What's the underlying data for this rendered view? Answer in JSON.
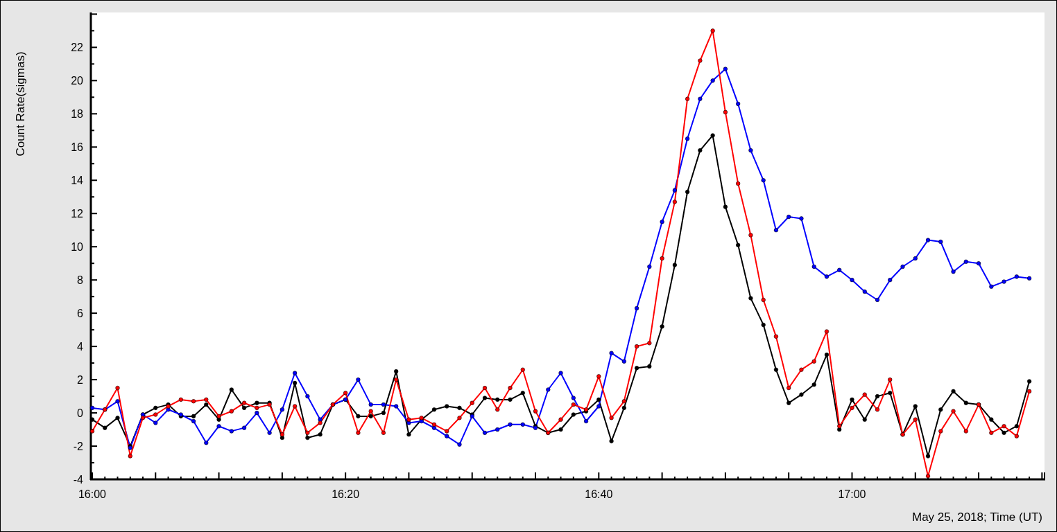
{
  "chart": {
    "chart_data": {
      "type": "line",
      "xlabel": "May 25, 2018; Time (UT)",
      "ylabel": "Count Rate(sigmas)",
      "categories": [
        "16:00",
        null,
        null,
        null,
        null,
        null,
        null,
        null,
        null,
        null,
        null,
        null,
        null,
        null,
        null,
        null,
        null,
        null,
        null,
        null,
        "16:20",
        null,
        null,
        null,
        null,
        null,
        null,
        null,
        null,
        null,
        null,
        null,
        null,
        null,
        null,
        null,
        null,
        null,
        null,
        null,
        "16:40",
        null,
        null,
        null,
        null,
        null,
        null,
        null,
        null,
        null,
        null,
        null,
        null,
        null,
        null,
        null,
        null,
        null,
        null,
        null,
        "17:00",
        null,
        null,
        null,
        null,
        null,
        null,
        null,
        null,
        null,
        null,
        null,
        null,
        null,
        null
      ],
      "ylim": [
        -4,
        24.1
      ],
      "yticks": [
        -4,
        -2,
        0,
        2,
        4,
        6,
        8,
        10,
        12,
        14,
        16,
        18,
        20,
        22
      ],
      "series": [
        {
          "color": "#000000",
          "marker": "circle",
          "values": [
            -0.4,
            -0.9,
            -0.3,
            -2.0,
            -0.1,
            0.3,
            0.5,
            -0.2,
            -0.2,
            0.5,
            -0.4,
            1.4,
            0.3,
            0.6,
            0.6,
            -1.5,
            1.8,
            -1.5,
            -1.3,
            0.5,
            0.8,
            -0.2,
            -0.2,
            0.0,
            2.5,
            -1.3,
            -0.4,
            0.2,
            0.4,
            0.3,
            -0.1,
            0.9,
            0.8,
            0.8,
            1.2,
            -0.8,
            -1.2,
            -1.0,
            -0.1,
            0.1,
            0.8,
            -1.7,
            0.3,
            2.7,
            2.8,
            5.2,
            8.9,
            13.3,
            15.8,
            16.7,
            12.4,
            10.1,
            6.9,
            5.3,
            2.6,
            0.6,
            1.1,
            1.7,
            3.5,
            -1.0,
            0.8,
            -0.4,
            1.0,
            1.2,
            -1.3,
            0.4,
            -2.6,
            0.2,
            1.3,
            0.6,
            0.5,
            -0.4,
            -1.2,
            -0.8,
            1.9
          ]
        },
        {
          "color": "#0000ff",
          "marker": "circle",
          "values": [
            0.3,
            0.2,
            0.7,
            -2.1,
            -0.1,
            -0.6,
            0.2,
            -0.1,
            -0.5,
            -1.8,
            -0.8,
            -1.1,
            -0.9,
            0.0,
            -1.2,
            0.2,
            2.4,
            1.0,
            -0.4,
            0.5,
            0.8,
            2.0,
            0.5,
            0.5,
            0.4,
            -0.6,
            -0.5,
            -0.9,
            -1.4,
            -1.9,
            -0.2,
            -1.2,
            -1.0,
            -0.7,
            -0.7,
            -0.9,
            1.4,
            2.4,
            0.9,
            -0.5,
            0.4,
            3.6,
            3.1,
            6.3,
            8.8,
            11.5,
            13.4,
            16.5,
            18.9,
            20.0,
            20.7,
            18.6,
            15.8,
            14.0,
            11.0,
            11.8,
            11.7,
            8.8,
            8.2,
            8.6,
            8.0,
            7.3,
            6.8,
            8.0,
            8.8,
            9.3,
            10.4,
            10.3,
            8.5,
            9.1,
            9.0,
            7.6,
            7.9,
            8.2,
            8.1
          ]
        },
        {
          "color": "#ff0000",
          "marker": "circle",
          "values": [
            -1.1,
            0.2,
            1.5,
            -2.6,
            -0.3,
            -0.1,
            0.4,
            0.8,
            0.7,
            0.8,
            -0.2,
            0.1,
            0.6,
            0.3,
            0.5,
            -1.3,
            0.4,
            -1.2,
            -0.6,
            0.5,
            1.2,
            -1.2,
            0.1,
            -1.2,
            2.0,
            -0.4,
            -0.3,
            -0.7,
            -1.1,
            -0.3,
            0.6,
            1.5,
            0.2,
            1.5,
            2.6,
            0.1,
            -1.2,
            -0.4,
            0.5,
            0.2,
            2.2,
            -0.3,
            0.7,
            4.0,
            4.2,
            9.3,
            12.7,
            18.9,
            21.2,
            23.0,
            18.1,
            13.8,
            10.7,
            6.8,
            4.6,
            1.5,
            2.6,
            3.1,
            4.9,
            -0.8,
            0.3,
            1.1,
            0.2,
            2.0,
            -1.3,
            -0.4,
            -3.8,
            -1.1,
            0.1,
            -1.1,
            0.5,
            -1.2,
            -0.8,
            -1.4,
            1.3
          ]
        }
      ]
    }
  }
}
